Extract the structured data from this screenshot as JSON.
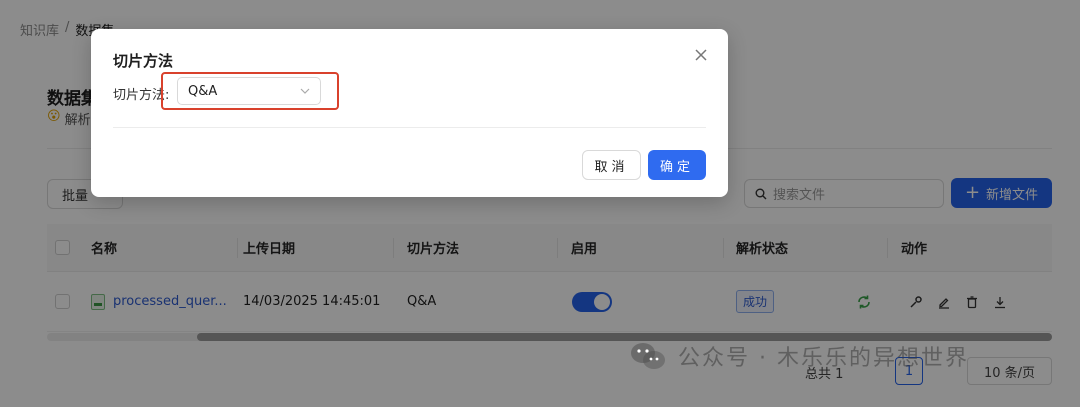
{
  "breadcrumb": {
    "root": "知识库",
    "separator": "/",
    "current": "数据集"
  },
  "dataset": {
    "title": "数据集",
    "subtitle_emoji": "😮",
    "subtitle": "解析..."
  },
  "toolbar": {
    "batch_label": "批量",
    "search_placeholder": "搜索文件",
    "add_label": "新增文件",
    "add_icon": "plus-icon",
    "accent_color": "#2563eb"
  },
  "table": {
    "columns": [
      "名称",
      "上传日期",
      "切片方法",
      "启用",
      "解析状态",
      "动作"
    ],
    "rows": [
      {
        "name": "processed_quer...",
        "upload_date": "14/03/2025 14:45:01",
        "chunk_method": "Q&A",
        "enabled": true,
        "status": "成功",
        "actions": [
          "refresh-icon",
          "wrench-icon",
          "edit-icon",
          "delete-icon",
          "download-icon"
        ]
      }
    ]
  },
  "pagination": {
    "total": "总共 1",
    "current_page": "1",
    "page_size": "10 条/页"
  },
  "watermark": {
    "text": "公众号 · 木乐乐的异想世界"
  },
  "modal": {
    "title": "切片方法",
    "field_label": "切片方法:",
    "selected_value": "Q&A",
    "cancel_label": "取消",
    "ok_label": "确定",
    "highlight_color": "#d9412c"
  }
}
